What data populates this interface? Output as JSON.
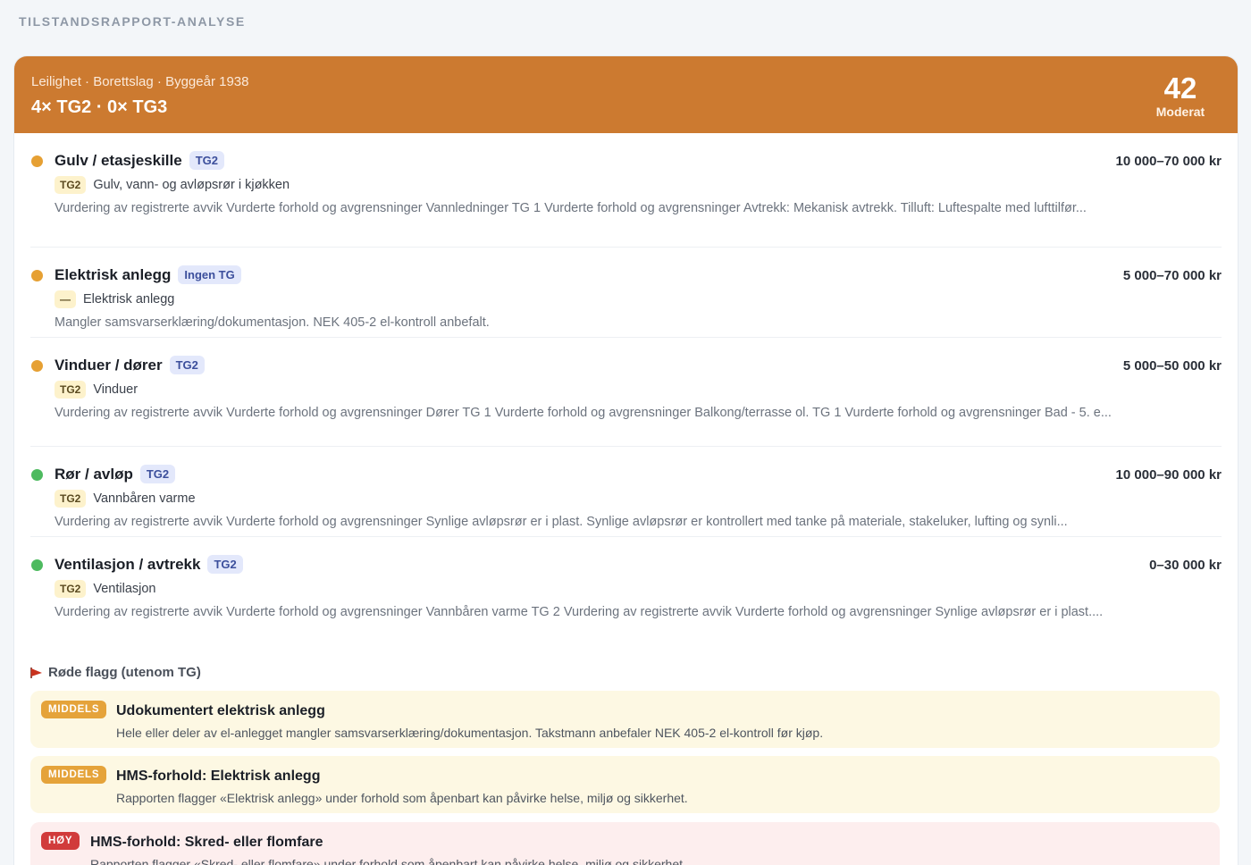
{
  "page": {
    "label": "TILSTANDSRAPPORT-ANALYSE"
  },
  "header": {
    "meta": "Leilighet · Borettslag · Byggeår 1938",
    "title": "4× TG2 · 0× TG3",
    "score": "42",
    "score_label": "Moderat",
    "color": "#cc7a30"
  },
  "items": [
    {
      "name": "Gulv / etasjeskille",
      "tg": "TG2",
      "cost": "10 000–70 000 kr",
      "dot": "orange",
      "sub_badge": "TG2",
      "sub_text": "Gulv, vann- og avløpsrør i kjøkken",
      "desc": "Vurdering av registrerte avvik Vurderte forhold og avgrensninger Vannledninger TG 1 Vurderte forhold og avgrensninger Avtrekk: Mekanisk avtrekk. Tilluft: Luftespalte med lufttilfør..."
    },
    {
      "name": "Elektrisk anlegg",
      "tg": "Ingen TG",
      "cost": "5 000–70 000 kr",
      "dot": "orange",
      "sub_badge": "—",
      "sub_text": "Elektrisk anlegg",
      "desc": "Mangler samsvarserklæring/dokumentasjon. NEK 405-2 el-kontroll anbefalt."
    },
    {
      "name": "Vinduer / dører",
      "tg": "TG2",
      "cost": "5 000–50 000 kr",
      "dot": "orange",
      "sub_badge": "TG2",
      "sub_text": "Vinduer",
      "desc": "Vurdering av registrerte avvik Vurderte forhold og avgrensninger Dører TG 1 Vurderte forhold og avgrensninger Balkong/terrasse ol. TG 1 Vurderte forhold og avgrensninger Bad - 5. e..."
    },
    {
      "name": "Rør / avløp",
      "tg": "TG2",
      "cost": "10 000–90 000 kr",
      "dot": "green",
      "sub_badge": "TG2",
      "sub_text": "Vannbåren varme",
      "desc": "Vurdering av registrerte avvik Vurderte forhold og avgrensninger Synlige avløpsrør er i plast. Synlige avløpsrør er kontrollert med tanke på materiale, stakeluker, lufting og synli..."
    },
    {
      "name": "Ventilasjon / avtrekk",
      "tg": "TG2",
      "cost": "0–30 000 kr",
      "dot": "green",
      "sub_badge": "TG2",
      "sub_text": "Ventilasjon",
      "desc": "Vurdering av registrerte avvik Vurderte forhold og avgrensninger Vannbåren varme TG 2 Vurdering av registrerte avvik Vurderte forhold og avgrensninger Synlige avløpsrør er i plast...."
    }
  ],
  "flags": {
    "heading": "Røde flagg (utenom TG)",
    "list": [
      {
        "severity": "MIDDELS",
        "level": "mid",
        "title": "Udokumentert elektrisk anlegg",
        "desc": "Hele eller deler av el-anlegget mangler samsvarserklæring/dokumentasjon. Takstmann anbefaler NEK 405-2 el-kontroll før kjøp."
      },
      {
        "severity": "MIDDELS",
        "level": "mid",
        "title": "HMS-forhold: Elektrisk anlegg",
        "desc": "Rapporten flagger «Elektrisk anlegg» under forhold som åpenbart kan påvirke helse, miljø og sikkerhet."
      },
      {
        "severity": "HØY",
        "level": "high",
        "title": "HMS-forhold: Skred- eller flomfare",
        "desc": "Rapporten flagger «Skred- eller flomfare» under forhold som åpenbart kan påvirke helse, miljø og sikkerhet."
      }
    ]
  }
}
